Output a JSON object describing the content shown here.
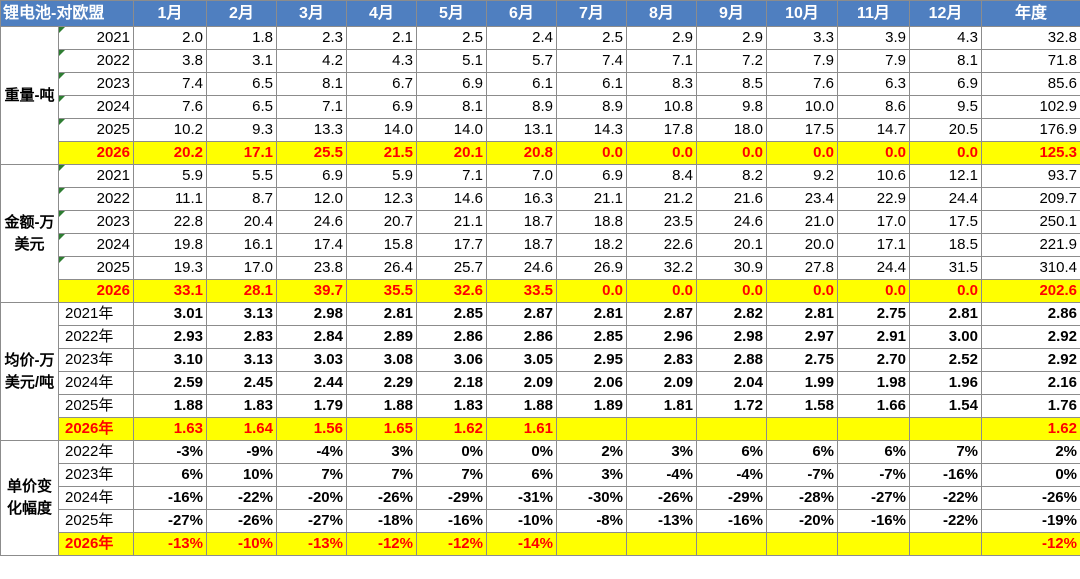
{
  "header": {
    "corner": "锂电池-对欧盟",
    "months": [
      "1月",
      "2月",
      "3月",
      "4月",
      "5月",
      "6月",
      "7月",
      "8月",
      "9月",
      "10月",
      "11月",
      "12月",
      "年度"
    ]
  },
  "groups": [
    {
      "label": "重量-吨",
      "bold": false,
      "year_align": "center",
      "marked": true,
      "rows": [
        {
          "year": "2021",
          "values": [
            "2.0",
            "1.8",
            "2.3",
            "2.1",
            "2.5",
            "2.4",
            "2.5",
            "2.9",
            "2.9",
            "3.3",
            "3.9",
            "4.3",
            "32.8"
          ]
        },
        {
          "year": "2022",
          "values": [
            "3.8",
            "3.1",
            "4.2",
            "4.3",
            "5.1",
            "5.7",
            "7.4",
            "7.1",
            "7.2",
            "7.9",
            "7.9",
            "8.1",
            "71.8"
          ]
        },
        {
          "year": "2023",
          "values": [
            "7.4",
            "6.5",
            "8.1",
            "6.7",
            "6.9",
            "6.1",
            "6.1",
            "8.3",
            "8.5",
            "7.6",
            "6.3",
            "6.9",
            "85.6"
          ]
        },
        {
          "year": "2024",
          "values": [
            "7.6",
            "6.5",
            "7.1",
            "6.9",
            "8.1",
            "8.9",
            "8.9",
            "10.8",
            "9.8",
            "10.0",
            "8.6",
            "9.5",
            "102.9"
          ]
        },
        {
          "year": "2025",
          "values": [
            "10.2",
            "9.3",
            "13.3",
            "14.0",
            "14.0",
            "13.1",
            "14.3",
            "17.8",
            "18.0",
            "17.5",
            "14.7",
            "20.5",
            "176.9"
          ]
        },
        {
          "year": "2026",
          "highlight": true,
          "values": [
            "20.2",
            "17.1",
            "25.5",
            "21.5",
            "20.1",
            "20.8",
            "0.0",
            "0.0",
            "0.0",
            "0.0",
            "0.0",
            "0.0",
            "125.3"
          ]
        }
      ]
    },
    {
      "label": "金额-万美元",
      "bold": false,
      "year_align": "center",
      "marked": true,
      "rows": [
        {
          "year": "2021",
          "values": [
            "5.9",
            "5.5",
            "6.9",
            "5.9",
            "7.1",
            "7.0",
            "6.9",
            "8.4",
            "8.2",
            "9.2",
            "10.6",
            "12.1",
            "93.7"
          ]
        },
        {
          "year": "2022",
          "values": [
            "11.1",
            "8.7",
            "12.0",
            "12.3",
            "14.6",
            "16.3",
            "21.1",
            "21.2",
            "21.6",
            "23.4",
            "22.9",
            "24.4",
            "209.7"
          ]
        },
        {
          "year": "2023",
          "values": [
            "22.8",
            "20.4",
            "24.6",
            "20.7",
            "21.1",
            "18.7",
            "18.8",
            "23.5",
            "24.6",
            "21.0",
            "17.0",
            "17.5",
            "250.1"
          ]
        },
        {
          "year": "2024",
          "values": [
            "19.8",
            "16.1",
            "17.4",
            "15.8",
            "17.7",
            "18.7",
            "18.2",
            "22.6",
            "20.1",
            "20.0",
            "17.1",
            "18.5",
            "221.9"
          ]
        },
        {
          "year": "2025",
          "values": [
            "19.3",
            "17.0",
            "23.8",
            "26.4",
            "25.7",
            "24.6",
            "26.9",
            "32.2",
            "30.9",
            "27.8",
            "24.4",
            "31.5",
            "310.4"
          ]
        },
        {
          "year": "2026",
          "highlight": true,
          "values": [
            "33.1",
            "28.1",
            "39.7",
            "35.5",
            "32.6",
            "33.5",
            "0.0",
            "0.0",
            "0.0",
            "0.0",
            "0.0",
            "0.0",
            "202.6"
          ]
        }
      ]
    },
    {
      "label": "均价-万美元/吨",
      "bold": true,
      "year_align": "left",
      "marked": false,
      "rows": [
        {
          "year": "2021年",
          "values": [
            "3.01",
            "3.13",
            "2.98",
            "2.81",
            "2.85",
            "2.87",
            "2.81",
            "2.87",
            "2.82",
            "2.81",
            "2.75",
            "2.81",
            "2.86"
          ]
        },
        {
          "year": "2022年",
          "values": [
            "2.93",
            "2.83",
            "2.84",
            "2.89",
            "2.86",
            "2.86",
            "2.85",
            "2.96",
            "2.98",
            "2.97",
            "2.91",
            "3.00",
            "2.92"
          ]
        },
        {
          "year": "2023年",
          "values": [
            "3.10",
            "3.13",
            "3.03",
            "3.08",
            "3.06",
            "3.05",
            "2.95",
            "2.83",
            "2.88",
            "2.75",
            "2.70",
            "2.52",
            "2.92"
          ]
        },
        {
          "year": "2024年",
          "values": [
            "2.59",
            "2.45",
            "2.44",
            "2.29",
            "2.18",
            "2.09",
            "2.06",
            "2.09",
            "2.04",
            "1.99",
            "1.98",
            "1.96",
            "2.16"
          ]
        },
        {
          "year": "2025年",
          "values": [
            "1.88",
            "1.83",
            "1.79",
            "1.88",
            "1.83",
            "1.88",
            "1.89",
            "1.81",
            "1.72",
            "1.58",
            "1.66",
            "1.54",
            "1.76"
          ]
        },
        {
          "year": "2026年",
          "highlight": true,
          "values": [
            "1.63",
            "1.64",
            "1.56",
            "1.65",
            "1.62",
            "1.61",
            "",
            "",
            "",
            "",
            "",
            "",
            "1.62"
          ]
        }
      ]
    },
    {
      "label": "单价变化幅度",
      "bold": true,
      "year_align": "left",
      "marked": false,
      "percent": true,
      "rows": [
        {
          "year": "2022年",
          "values": [
            "-3%",
            "-9%",
            "-4%",
            "3%",
            "0%",
            "0%",
            "2%",
            "3%",
            "6%",
            "6%",
            "6%",
            "7%",
            "2%"
          ]
        },
        {
          "year": "2023年",
          "values": [
            "6%",
            "10%",
            "7%",
            "7%",
            "7%",
            "6%",
            "3%",
            "-4%",
            "-4%",
            "-7%",
            "-7%",
            "-16%",
            "0%"
          ]
        },
        {
          "year": "2024年",
          "values": [
            "-16%",
            "-22%",
            "-20%",
            "-26%",
            "-29%",
            "-31%",
            "-30%",
            "-26%",
            "-29%",
            "-28%",
            "-27%",
            "-22%",
            "-26%"
          ]
        },
        {
          "year": "2025年",
          "values": [
            "-27%",
            "-26%",
            "-27%",
            "-18%",
            "-16%",
            "-10%",
            "-8%",
            "-13%",
            "-16%",
            "-20%",
            "-16%",
            "-22%",
            "-19%"
          ]
        },
        {
          "year": "2026年",
          "highlight": true,
          "values": [
            "-13%",
            "-10%",
            "-13%",
            "-12%",
            "-12%",
            "-14%",
            "",
            "",
            "",
            "",
            "",
            "",
            "-12%"
          ]
        }
      ]
    }
  ],
  "colors": {
    "header_bg": "#4f7fc0",
    "highlight_bg": "#ffff00",
    "highlight_text": "#ff0000",
    "grid": "#8c8c8c"
  }
}
